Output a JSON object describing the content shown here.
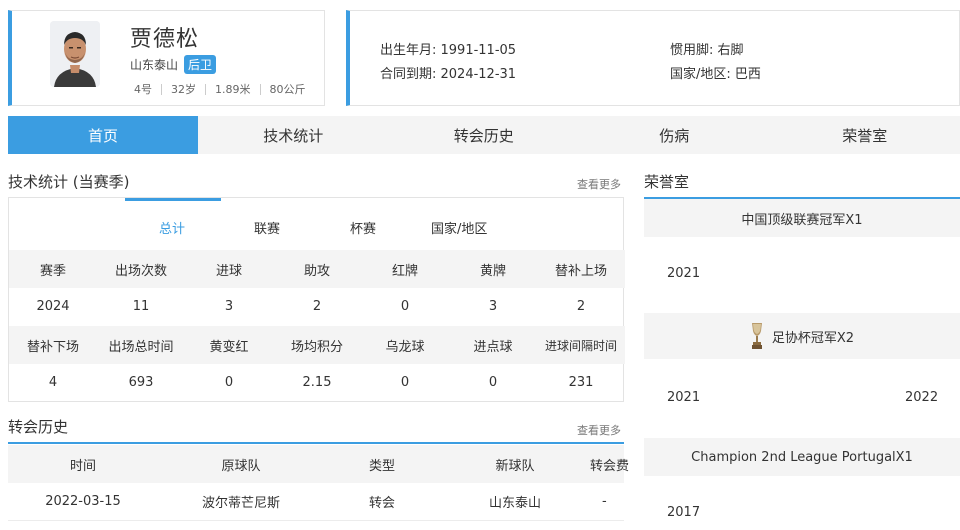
{
  "player": {
    "name": "贾德松",
    "team": "山东泰山",
    "position": "后卫",
    "number": "4号",
    "age": "32岁",
    "height": "1.89米",
    "weight": "80公斤"
  },
  "info": {
    "birth": "出生年月: 1991-11-05",
    "contract": "合同到期: 2024-12-31",
    "foot": "惯用脚: 右脚",
    "nationality": "国家/地区: 巴西"
  },
  "tabs": [
    "首页",
    "技术统计",
    "转会历史",
    "伤病",
    "荣誉室"
  ],
  "stats_section": {
    "title": "技术统计 (当赛季)",
    "more": "查看更多",
    "sub_tabs": [
      "总计",
      "联赛",
      "杯赛",
      "国家/地区"
    ],
    "header1": [
      "赛季",
      "出场次数",
      "进球",
      "助攻",
      "红牌",
      "黄牌",
      "替补上场"
    ],
    "row1": [
      "2024",
      "11",
      "3",
      "2",
      "0",
      "3",
      "2"
    ],
    "header2": [
      "替补下场",
      "出场总时间",
      "黄变红",
      "场均积分",
      "乌龙球",
      "进点球",
      "进球间隔时间"
    ],
    "row2": [
      "4",
      "693",
      "0",
      "2.15",
      "0",
      "0",
      "231"
    ]
  },
  "transfer_section": {
    "title": "转会历史",
    "more": "查看更多",
    "columns": [
      "时间",
      "原球队",
      "类型",
      "新球队",
      "转会费"
    ],
    "rows": [
      [
        "2022-03-15",
        "波尔蒂芒尼斯",
        "转会",
        "山东泰山",
        "-"
      ]
    ]
  },
  "honors_section": {
    "title": "荣誉室",
    "items": [
      {
        "label": "中国顶级联赛冠军X1",
        "years": [
          "2021"
        ]
      },
      {
        "label": "足协杯冠军X2",
        "years": [
          "2021",
          "2022"
        ]
      },
      {
        "label": "Champion 2nd League PortugalX1",
        "years": [
          "2017"
        ]
      }
    ]
  },
  "colors": {
    "accent": "#3b9de1",
    "tab_bg": "#f4f4f4"
  }
}
